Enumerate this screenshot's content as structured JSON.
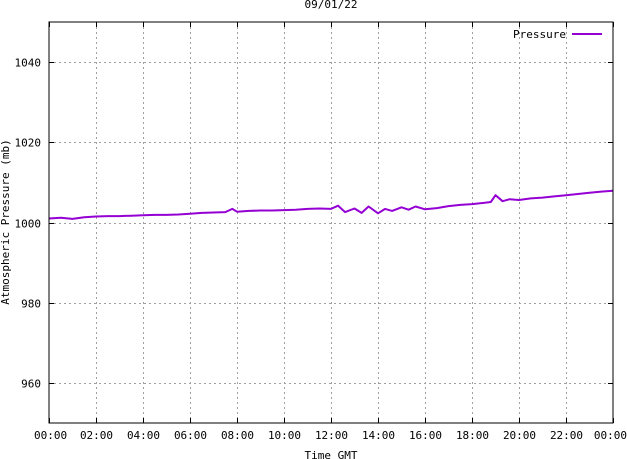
{
  "chart_data": {
    "type": "line",
    "title": "09/01/22",
    "xlabel": "Time GMT",
    "ylabel": "Atmospheric Pressure (mb)",
    "xlim": [
      0,
      24
    ],
    "ylim": [
      950,
      1050
    ],
    "x_ticks": [
      "00:00",
      "02:00",
      "04:00",
      "06:00",
      "08:00",
      "10:00",
      "12:00",
      "14:00",
      "16:00",
      "18:00",
      "20:00",
      "22:00",
      "00:00"
    ],
    "y_ticks": [
      960,
      980,
      1000,
      1020,
      1040
    ],
    "grid": true,
    "legend_position": "top-right",
    "series": [
      {
        "name": "Pressure",
        "color": "#9400d3",
        "x": [
          0,
          0.5,
          1,
          1.5,
          2,
          2.5,
          3,
          3.5,
          4,
          4.5,
          5,
          5.5,
          6,
          6.5,
          7,
          7.5,
          7.8,
          8,
          8.5,
          9,
          9.5,
          10,
          10.5,
          11,
          11.5,
          12,
          12.3,
          12.6,
          13,
          13.3,
          13.6,
          14,
          14.3,
          14.6,
          15,
          15.3,
          15.6,
          16,
          16.5,
          17,
          17.5,
          18,
          18.5,
          18.8,
          19,
          19.3,
          19.6,
          20,
          20.5,
          21,
          21.5,
          22,
          22.5,
          23,
          23.5,
          24
        ],
        "values": [
          1001.0,
          1001.2,
          1000.9,
          1001.3,
          1001.5,
          1001.6,
          1001.6,
          1001.7,
          1001.8,
          1001.9,
          1001.9,
          1002.0,
          1002.2,
          1002.4,
          1002.5,
          1002.6,
          1003.4,
          1002.7,
          1002.9,
          1003.0,
          1003.0,
          1003.1,
          1003.2,
          1003.4,
          1003.5,
          1003.4,
          1004.2,
          1002.6,
          1003.5,
          1002.4,
          1004.0,
          1002.3,
          1003.4,
          1002.9,
          1003.8,
          1003.2,
          1004.0,
          1003.3,
          1003.6,
          1004.1,
          1004.4,
          1004.6,
          1004.9,
          1005.1,
          1006.8,
          1005.3,
          1005.8,
          1005.6,
          1006.0,
          1006.2,
          1006.5,
          1006.8,
          1007.1,
          1007.4,
          1007.7,
          1007.9
        ]
      }
    ]
  }
}
